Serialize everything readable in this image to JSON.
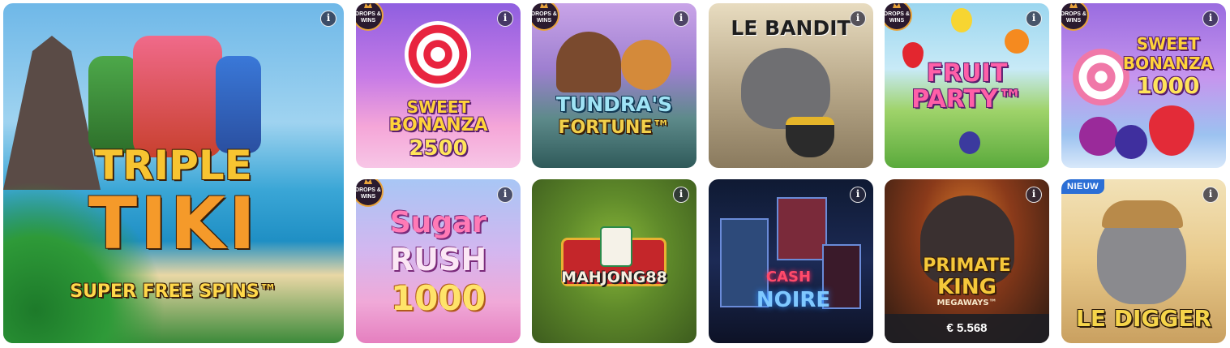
{
  "info_glyph": "i",
  "drops_label": "DROPS & WINS",
  "featured": {
    "title_line1": "TRIPLE",
    "title_line2": "TIKI",
    "subtitle": "SUPER FREE SPINS™"
  },
  "games": [
    {
      "id": "sweet-bonanza-2500",
      "line1": "SWEET",
      "line2": "BONANZA",
      "line3": "2500",
      "drops": true
    },
    {
      "id": "tundras-fortune",
      "line1": "TUNDRA'S",
      "line2": "FORTUNE™",
      "drops": true
    },
    {
      "id": "le-bandit",
      "line1": "LE BANDIT",
      "drops": false
    },
    {
      "id": "fruit-party",
      "line1": "FRUIT",
      "line2": "PARTY™",
      "drops": true
    },
    {
      "id": "sweet-bonanza-1000",
      "line1": "SWEET",
      "line2": "BONANZA",
      "line3": "1000",
      "drops": true
    },
    {
      "id": "sugar-rush-1000",
      "line1": "Sugar",
      "line2": "RUSH",
      "line3": "1000",
      "drops": true
    },
    {
      "id": "mahjong-88",
      "line1": "MAHJONG88",
      "drops": false
    },
    {
      "id": "cash-noire",
      "line1": "CASH",
      "line2": "NOIRE",
      "drops": false
    },
    {
      "id": "primate-king",
      "line1": "PRIMATE",
      "line2": "KING",
      "line3": "MEGAWAYS™",
      "jackpot": "€ 5.568",
      "drops": false
    },
    {
      "id": "le-digger",
      "line1": "LE DIGGER",
      "badge": "NIEUW",
      "drops": false
    }
  ]
}
